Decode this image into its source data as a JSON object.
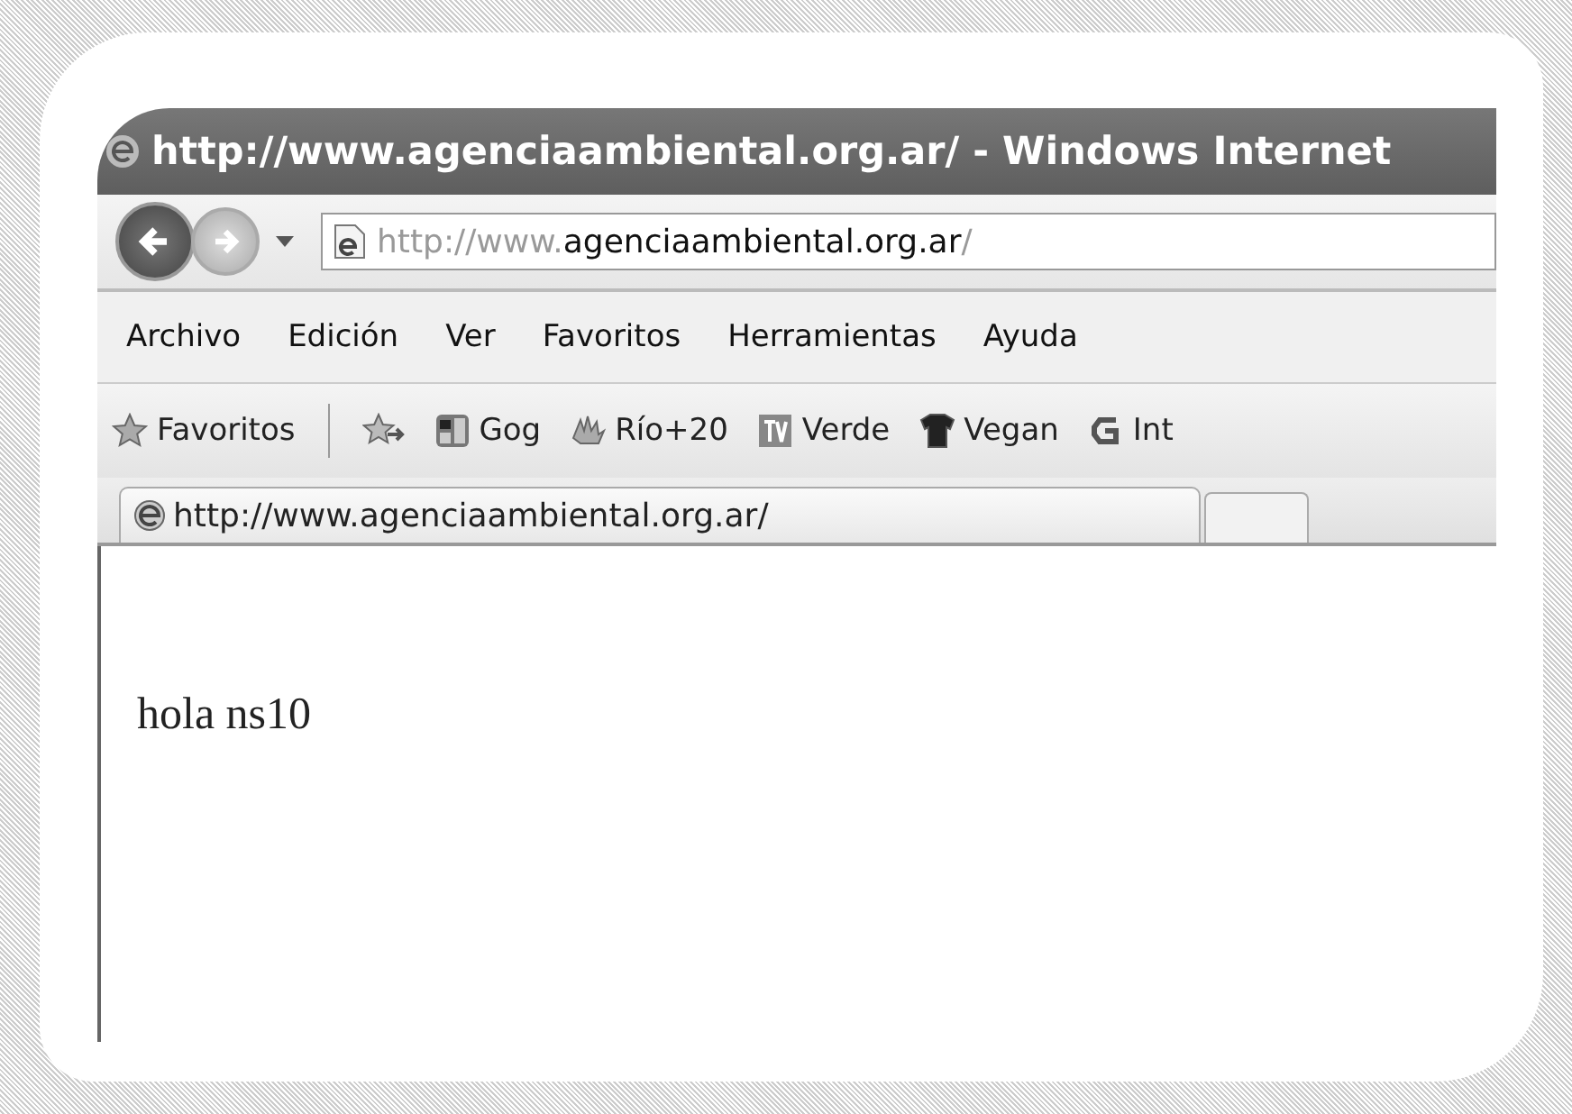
{
  "window": {
    "title": "http://www.agenciaambiental.org.ar/ - Windows Internet"
  },
  "address": {
    "prefix": "http://www.",
    "domain": "agenciaambiental.org.ar",
    "suffix": "/"
  },
  "menu": [
    "Archivo",
    "Edición",
    "Ver",
    "Favoritos",
    "Herramientas",
    "Ayuda"
  ],
  "favorites": {
    "label": "Favoritos",
    "links": [
      {
        "label": "Gog",
        "kind": "google"
      },
      {
        "label": "Río+20",
        "kind": "hand"
      },
      {
        "label": "Verde",
        "kind": "tv"
      },
      {
        "label": "Vegan",
        "kind": "shirt"
      },
      {
        "label": "Int",
        "kind": "g"
      }
    ]
  },
  "tabs": [
    {
      "label": "http://www.agenciaambiental.org.ar/",
      "selected": true
    }
  ],
  "page": {
    "text": "hola ns10"
  }
}
